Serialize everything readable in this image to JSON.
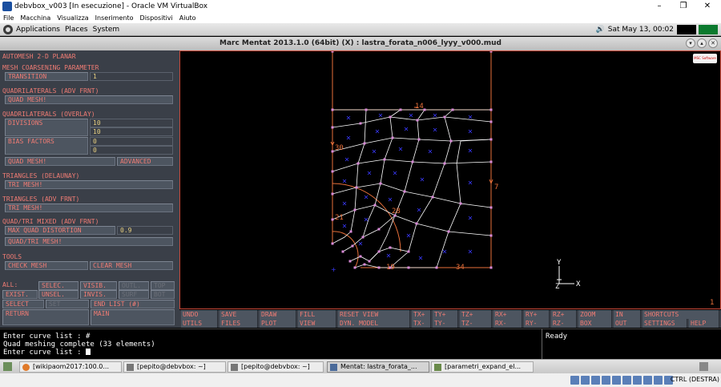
{
  "host": {
    "title": "debvbox_v003 [In esecuzione] - Oracle VM VirtualBox",
    "menu": [
      "File",
      "Macchina",
      "Visualizza",
      "Inserimento",
      "Dispositivi",
      "Aiuto"
    ],
    "minimize": "–",
    "maximize": "❐",
    "close": "✕"
  },
  "gnome": {
    "applications": "Applications",
    "places": "Places",
    "system": "System",
    "datetime": "Sat May 13, 00:02"
  },
  "mentat": {
    "title": "Marc Mentat 2013.1.0 (64bit) (X) : lastra_forata_n006_lyyy_v000.mud"
  },
  "left": {
    "automesh": "AUTOMESH 2-D PLANAR",
    "coarsening_header": "MESH COARSENING PARAMETER",
    "transition_label": "TRANSITION",
    "transition_value": "1",
    "quad_adv_header": "QUADRILATERALS (ADV FRNT)",
    "quad_mesh1": "QUAD MESH!",
    "quad_overlay_header": "QUADRILATERALS (OVERLAY)",
    "divisions_label": "DIVISIONS",
    "divisions_values": [
      "10",
      "10"
    ],
    "bias_label": "BIAS FACTORS",
    "bias_values": [
      "0",
      "0"
    ],
    "quad_mesh2": "QUAD MESH!",
    "advanced": "ADVANCED",
    "tri_delaunay_header": "TRIANGLES (DELAUNAY)",
    "tri_mesh1": "TRI MESH!",
    "tri_adv_header": "TRIANGLES (ADV FRNT)",
    "tri_mesh2": "TRI MESH!",
    "quadtri_header": "QUAD/TRI MIXED (ADV FRNT)",
    "max_distortion_label": "MAX QUAD DISTORTION",
    "max_distortion_value": "0.9",
    "quadtri_mesh": "QUAD/TRI MESH!",
    "tools_header": "TOOLS",
    "check_mesh": "CHECK MESH",
    "clear_mesh": "CLEAR MESH",
    "sel_all": "ALL:",
    "sel_selec": "SELEC.",
    "sel_visib": "VISIB.",
    "sel_outl": "OUTL.",
    "sel_top": "TOP",
    "sel_exist": "EXIST.",
    "sel_unsel": "UNSEL.",
    "sel_invis": "INVIS.",
    "sel_surf": "SURF",
    "sel_bot": "BOT",
    "select": "SELECT",
    "set": "SET",
    "end_list": "END LIST (#)",
    "return": "RETURN",
    "main": "MAIN"
  },
  "toolbar": {
    "row1": [
      "UNDO",
      "SAVE",
      "DRAW",
      "FILL",
      "RESET VIEW",
      "TX+",
      "TY+",
      "TZ+",
      "RX+",
      "RY+",
      "RZ+",
      "ZOOM",
      "IN",
      "SHORTCUTS"
    ],
    "row2": [
      "UTILS",
      "FILES",
      "PLOT",
      "VIEW",
      "DYN. MODEL",
      "TX-",
      "TY-",
      "TZ-",
      "RX-",
      "RY-",
      "RZ-",
      "BOX",
      "OUT",
      "SETTINGS",
      "HELP"
    ]
  },
  "canvas": {
    "logo": "MSC Software",
    "labels": {
      "l14": "14",
      "l30": "30",
      "l7": "7",
      "l21": "21",
      "l28": "28",
      "l19": "19",
      "l34": "34",
      "l1": "1"
    },
    "axis_y": "Y",
    "axis_x": "X",
    "axis_z": "Z"
  },
  "command": {
    "line1": "Enter curve list : #",
    "line2": "Quad meshing complete (33 elements)",
    "line3": "Enter curve list : "
  },
  "status": "Ready",
  "taskbar": {
    "items": [
      "[wikipaom2017:100.0...",
      "[pepito@debvbox: ~]",
      "[pepito@debvbox: ~]",
      "Mentat: lastra_forata_...",
      "[parametri_expand_el..."
    ]
  },
  "vbox_status": {
    "host_key": "CTRL (DESTRA)"
  },
  "colors": {
    "menu_text": "#f07c74",
    "mesh_line": "#ffffff",
    "node": "#d98ad8",
    "border": "#e8703a",
    "element_mark": "#3a3aff"
  }
}
